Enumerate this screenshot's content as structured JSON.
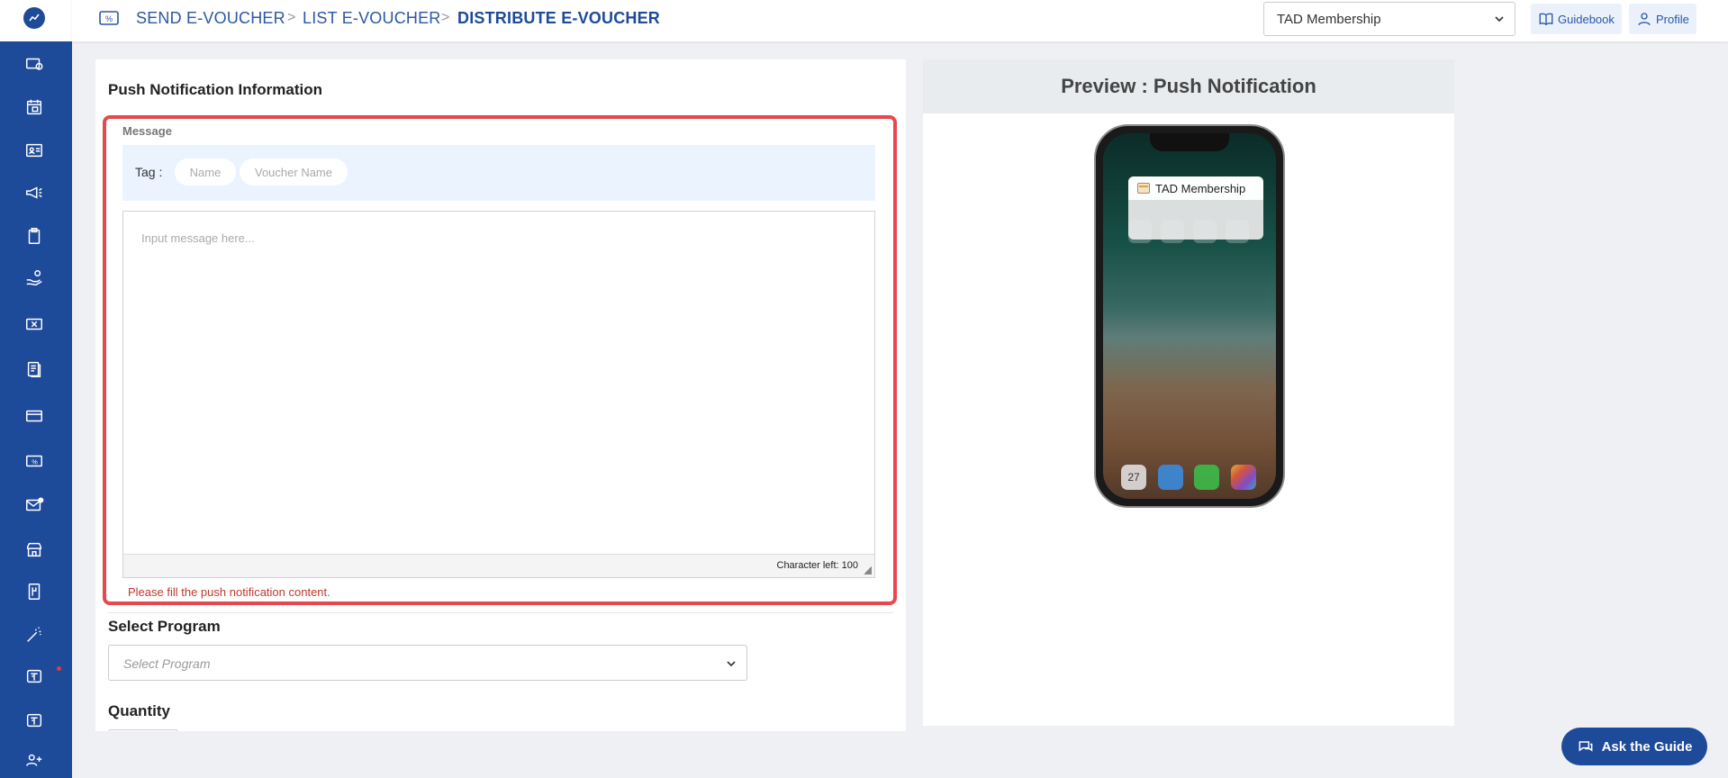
{
  "breadcrumb": {
    "items": [
      {
        "label": "SEND E-VOUCHER"
      },
      {
        "label": "LIST E-VOUCHER"
      },
      {
        "label": "DISTRIBUTE E-VOUCHER"
      }
    ],
    "separator": ">"
  },
  "header": {
    "membership_select": "TAD Membership",
    "guidebook_label": "Guidebook",
    "profile_label": "Profile"
  },
  "form": {
    "section_title": "Push Notification Information",
    "message_label": "Message",
    "tag_label": "Tag :",
    "tags": [
      "Name",
      "Voucher Name"
    ],
    "message_placeholder": "Input message here...",
    "char_left": "Character left: 100",
    "error": "Please fill the push notification content.",
    "program_title": "Select Program",
    "program_placeholder": "Select Program",
    "quantity_title": "Quantity"
  },
  "preview": {
    "title": "Preview : Push Notification",
    "notification_app": "TAD Membership",
    "dock_date": "27"
  },
  "help": {
    "ask_label": "Ask the Guide"
  },
  "colors": {
    "primary": "#1e4a9a",
    "highlight": "#e5484d",
    "error": "#c0392b"
  },
  "sidebar": {
    "icons": [
      "voucher-icon",
      "calendar-icon",
      "member-card-icon",
      "megaphone-icon",
      "clipboard-icon",
      "hand-coin-icon",
      "ticket-icon",
      "document-icon",
      "credit-card-icon",
      "e-voucher-icon",
      "mail-icon",
      "store-icon",
      "receipt-icon",
      "magic-wand-icon",
      "tad-icon",
      "tad-icon-2",
      "add-user-icon"
    ]
  }
}
